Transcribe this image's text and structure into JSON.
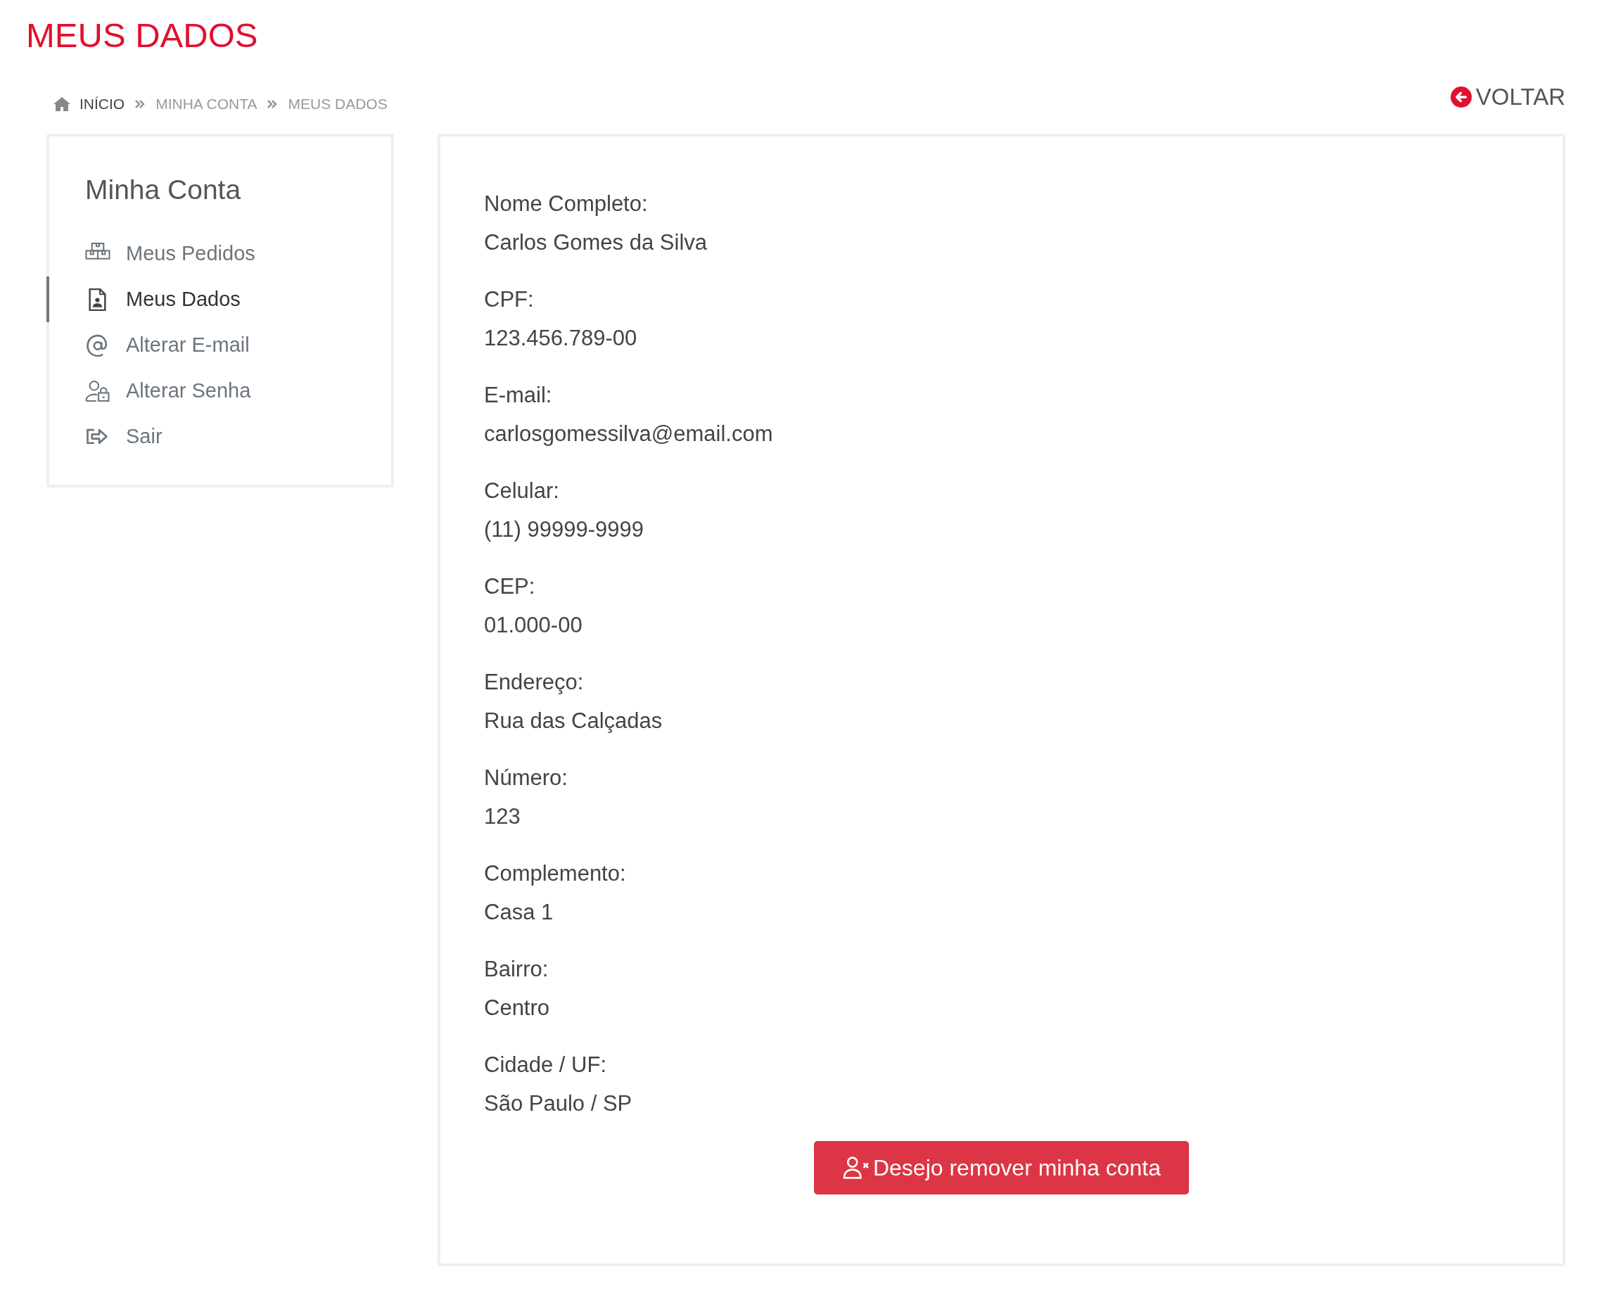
{
  "page_title": "MEUS DADOS",
  "breadcrumb": [
    {
      "label": "INÍCIO",
      "kind": "home",
      "current": false
    },
    {
      "label": "MINHA CONTA",
      "kind": "page",
      "current": true
    },
    {
      "label": "MEUS DADOS",
      "kind": "page",
      "current": true
    }
  ],
  "back_link": "VOLTAR",
  "sidebar": {
    "title": "Minha Conta",
    "items": [
      {
        "label": "Meus Pedidos",
        "kind": "orders",
        "selected": false
      },
      {
        "label": "Meus Dados",
        "kind": "profile",
        "selected": true
      },
      {
        "label": "Alterar E-mail",
        "kind": "email",
        "selected": false
      },
      {
        "label": "Alterar Senha",
        "kind": "password",
        "selected": false
      },
      {
        "label": "Sair",
        "kind": "logout",
        "selected": false
      }
    ]
  },
  "fields": [
    {
      "label": "Nome Completo:",
      "value": "Carlos Gomes da Silva"
    },
    {
      "label": "CPF:",
      "value": "123.456.789-00"
    },
    {
      "label": "E-mail:",
      "value": "carlosgomessilva@email.com"
    },
    {
      "label": "Celular:",
      "value": "(11) 99999-9999"
    },
    {
      "label": "CEP:",
      "value": "01.000-00"
    },
    {
      "label": "Endereço:",
      "value": "Rua das Calçadas"
    },
    {
      "label": "Número:",
      "value": "123"
    },
    {
      "label": "Complemento:",
      "value": "Casa 1"
    },
    {
      "label": "Bairro:",
      "value": "Centro"
    },
    {
      "label": "Cidade / UF:",
      "value": "São Paulo / SP"
    }
  ],
  "remove_button": "Desejo remover minha conta"
}
